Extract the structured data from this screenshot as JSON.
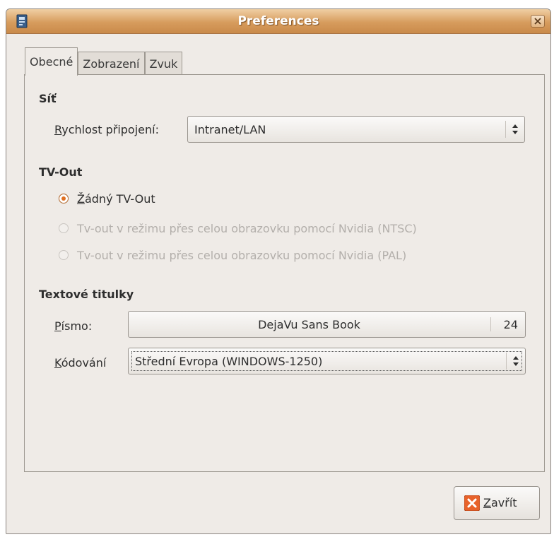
{
  "window": {
    "title": "Preferences"
  },
  "tabs": [
    {
      "label": "Obecné",
      "active": true
    },
    {
      "label": "Zobrazení",
      "active": false
    },
    {
      "label": "Zvuk",
      "active": false
    }
  ],
  "network": {
    "heading": "Síť",
    "speed_label_key": "R",
    "speed_label_rest": "ychlost připojení:",
    "speed_value": "Intranet/LAN"
  },
  "tvout": {
    "heading": "TV-Out",
    "options": [
      {
        "key": "Ž",
        "rest": "ádný TV-Out",
        "checked": true,
        "disabled": false
      },
      {
        "key": "",
        "rest": "Tv-out v režimu přes celou obrazovku pomocí Nvidia (NTSC)",
        "checked": false,
        "disabled": true
      },
      {
        "key": "",
        "rest": "Tv-out v režimu přes celou obrazovku pomocí Nvidia (PAL)",
        "checked": false,
        "disabled": true
      }
    ]
  },
  "subtitles": {
    "heading": "Textové titulky",
    "font_label_key": "P",
    "font_label_rest": "ísmo:",
    "font_name": "DejaVu Sans Book",
    "font_size": "24",
    "encoding_label_key": "K",
    "encoding_label_rest": "ódování",
    "encoding_value": "Střední Evropa (WINDOWS-1250)"
  },
  "footer": {
    "close_key": "Z",
    "close_rest": "avřít"
  },
  "colors": {
    "titlebar": "#d79c5d",
    "radio_accent": "#e07021",
    "close_icon": "#e8622a"
  },
  "icons": {
    "app": "app-icon",
    "window_close": "close-icon",
    "combo_arrows": "updown-arrows-icon",
    "close_button": "close-x-icon"
  }
}
